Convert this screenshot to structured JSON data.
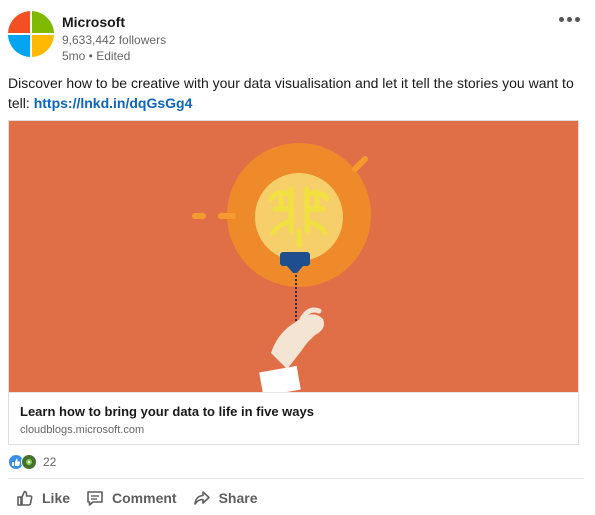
{
  "post": {
    "author": "Microsoft",
    "followers": "9,633,442 followers",
    "meta": "5mo • Edited",
    "text": "Discover how to be creative with your data visualisation and let it tell the stories you want to tell: ",
    "link": "https://lnkd.in/dqGsGg4"
  },
  "logo": {
    "colors": [
      "#f25022",
      "#7fba00",
      "#00a4ef",
      "#ffb900"
    ]
  },
  "article": {
    "title": "Learn how to bring your data to life in five ways",
    "source": "cloudblogs.microsoft.com",
    "image_bg": "#e06f47"
  },
  "reactions": {
    "count": "22",
    "icons": [
      "like-icon",
      "celebrate-icon"
    ]
  },
  "actions": [
    {
      "label": "Like",
      "icon": "thumbs-up-icon"
    },
    {
      "label": "Comment",
      "icon": "comment-icon"
    },
    {
      "label": "Share",
      "icon": "share-icon"
    }
  ],
  "colors": {
    "link": "#0a66c2",
    "muted_text": "#666666"
  }
}
